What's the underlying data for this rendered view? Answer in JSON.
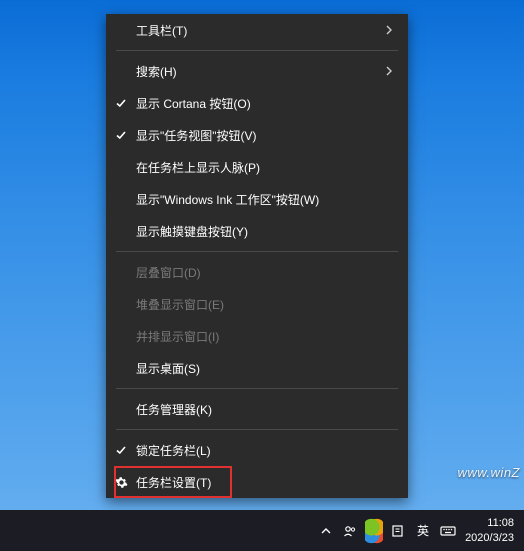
{
  "menu": {
    "items": [
      {
        "label": "工具栏(T)",
        "icon": null,
        "hasSubmenu": true,
        "disabled": false
      },
      {
        "separator": true
      },
      {
        "label": "搜索(H)",
        "icon": null,
        "hasSubmenu": true,
        "disabled": false
      },
      {
        "label": "显示 Cortana 按钮(O)",
        "icon": "check",
        "hasSubmenu": false,
        "disabled": false
      },
      {
        "label": "显示\"任务视图\"按钮(V)",
        "icon": "check",
        "hasSubmenu": false,
        "disabled": false
      },
      {
        "label": "在任务栏上显示人脉(P)",
        "icon": null,
        "hasSubmenu": false,
        "disabled": false
      },
      {
        "label": "显示\"Windows Ink 工作区\"按钮(W)",
        "icon": null,
        "hasSubmenu": false,
        "disabled": false
      },
      {
        "label": "显示触摸键盘按钮(Y)",
        "icon": null,
        "hasSubmenu": false,
        "disabled": false
      },
      {
        "separator": true
      },
      {
        "label": "层叠窗口(D)",
        "icon": null,
        "hasSubmenu": false,
        "disabled": true
      },
      {
        "label": "堆叠显示窗口(E)",
        "icon": null,
        "hasSubmenu": false,
        "disabled": true
      },
      {
        "label": "并排显示窗口(I)",
        "icon": null,
        "hasSubmenu": false,
        "disabled": true
      },
      {
        "label": "显示桌面(S)",
        "icon": null,
        "hasSubmenu": false,
        "disabled": false
      },
      {
        "separator": true
      },
      {
        "label": "任务管理器(K)",
        "icon": null,
        "hasSubmenu": false,
        "disabled": false
      },
      {
        "separator": true
      },
      {
        "label": "锁定任务栏(L)",
        "icon": "check",
        "hasSubmenu": false,
        "disabled": false
      },
      {
        "label": "任务栏设置(T)",
        "icon": "gear",
        "hasSubmenu": false,
        "disabled": false,
        "highlight": true
      }
    ]
  },
  "taskbar": {
    "ime": "英",
    "time": "11:08",
    "date": "2020/3/23"
  },
  "watermark": "www.winZ"
}
